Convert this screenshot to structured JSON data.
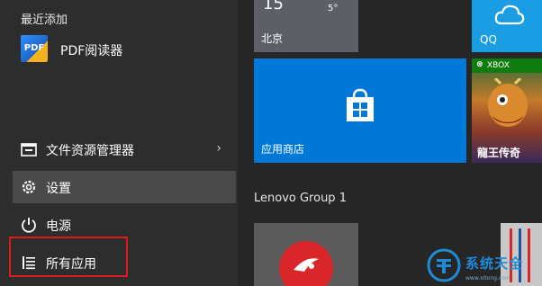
{
  "left_panel": {
    "recently_added_label": "最近添加",
    "recent_app": {
      "label": "PDF阅读器",
      "icon_text": "PDF"
    },
    "items": [
      {
        "label": "文件资源管理器",
        "icon": "file-explorer-icon",
        "chevron": "›"
      },
      {
        "label": "设置",
        "icon": "gear-icon"
      },
      {
        "label": "电源",
        "icon": "power-icon"
      },
      {
        "label": "所有应用",
        "icon": "list-icon"
      }
    ]
  },
  "tiles": {
    "weather": {
      "temp": "15",
      "low": "5°",
      "city": "北京"
    },
    "qq": {
      "label": "QQ"
    },
    "store": {
      "label": "应用商店"
    },
    "xbox": {
      "label": "XBOX",
      "game_label": "龍王传奇"
    }
  },
  "group": {
    "label": "Lenovo Group 1"
  },
  "watermark": {
    "text": "系统天全",
    "sub": "www.xitong.com"
  },
  "colors": {
    "accent": "#0078d7",
    "highlight_box": "#e0191b"
  }
}
